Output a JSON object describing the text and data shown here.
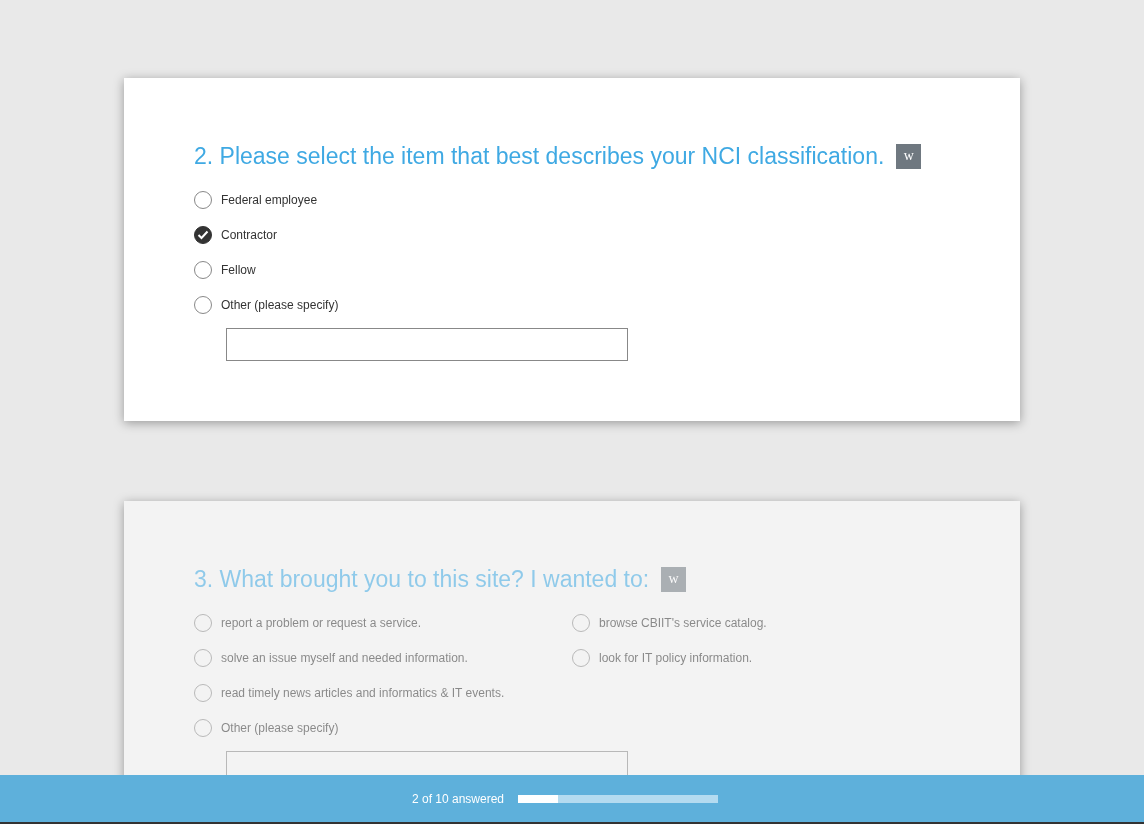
{
  "questions": [
    {
      "title": "2. Please select the item that best describes your NCI classification.",
      "badge": "w",
      "active": true,
      "columns": [
        [
          {
            "label": "Federal employee",
            "selected": false
          },
          {
            "label": "Contractor",
            "selected": true
          },
          {
            "label": "Fellow",
            "selected": false
          },
          {
            "label": "Other (please specify)",
            "selected": false
          }
        ]
      ],
      "other_field": true
    },
    {
      "title": "3. What brought you to this site? I wanted to:",
      "badge": "w",
      "active": false,
      "columns": [
        [
          {
            "label": "report a problem or request a service.",
            "selected": false
          },
          {
            "label": "solve an issue myself and needed information.",
            "selected": false
          },
          {
            "label": "read timely news articles and informatics & IT events.",
            "selected": false
          },
          {
            "label": "Other (please specify)",
            "selected": false
          }
        ],
        [
          {
            "label": "browse CBIIT's service catalog.",
            "selected": false
          },
          {
            "label": "look for IT policy information.",
            "selected": false
          }
        ]
      ],
      "other_field": true
    }
  ],
  "progress": {
    "label": "2 of 10 answered",
    "level": 0.2
  }
}
